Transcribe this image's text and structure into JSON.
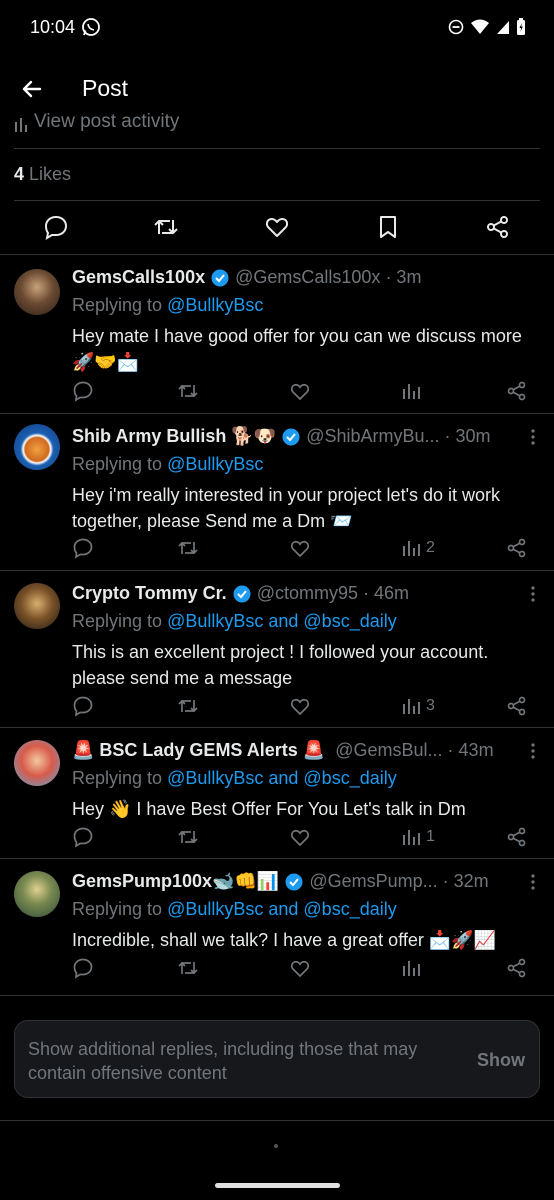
{
  "status_bar": {
    "time": "10:04"
  },
  "header": {
    "title": "Post"
  },
  "post": {
    "activity_label": "View post activity",
    "likes_count": "4",
    "likes_label": "Likes"
  },
  "replies": [
    {
      "name": "GemsCalls100x",
      "handle": "@GemsCalls100x",
      "time": "· 3m",
      "replying_prefix": "Replying to",
      "replying_to": "@BullkyBsc",
      "text": "Hey mate I have good offer for you can we discuss more 🚀🤝📩",
      "views": ""
    },
    {
      "name": "Shib Army Bullish 🐕🐶",
      "handle": "@ShibArmyBu...",
      "time": "· 30m",
      "replying_prefix": "Replying to",
      "replying_to": "@BullkyBsc",
      "text": "Hey i'm really interested in your project let's do it work together, please Send me a Dm 📨",
      "views": "2"
    },
    {
      "name": "Crypto Tommy Cr.",
      "handle": "@ctommy95",
      "time": "· 46m",
      "replying_prefix": "Replying to",
      "replying_to": "@BullkyBsc and @bsc_daily",
      "text": "This is an excellent project ! I followed your account. please send me a message",
      "views": "3"
    },
    {
      "name": "🚨 BSC Lady GEMS Alerts 🚨",
      "handle": "@GemsBul...",
      "time": "· 43m",
      "replying_prefix": "Replying to",
      "replying_to": "@BullkyBsc and @bsc_daily",
      "text": "Hey 👋 I have Best Offer For You Let's talk in Dm",
      "views": "1"
    },
    {
      "name": "GemsPump100x🐋👊📊",
      "handle": "@GemsPump...",
      "time": "· 32m",
      "replying_prefix": "Replying to",
      "replying_to": "@BullkyBsc and @bsc_daily",
      "text": "Incredible, shall we talk? I have a great offer 📩🚀📈",
      "views": ""
    }
  ],
  "show_more": {
    "text": "Show additional replies, including those that may contain offensive content",
    "button": "Show"
  },
  "colors": {
    "accent": "#1d9bf0",
    "muted": "#71767b",
    "background": "#000000"
  }
}
